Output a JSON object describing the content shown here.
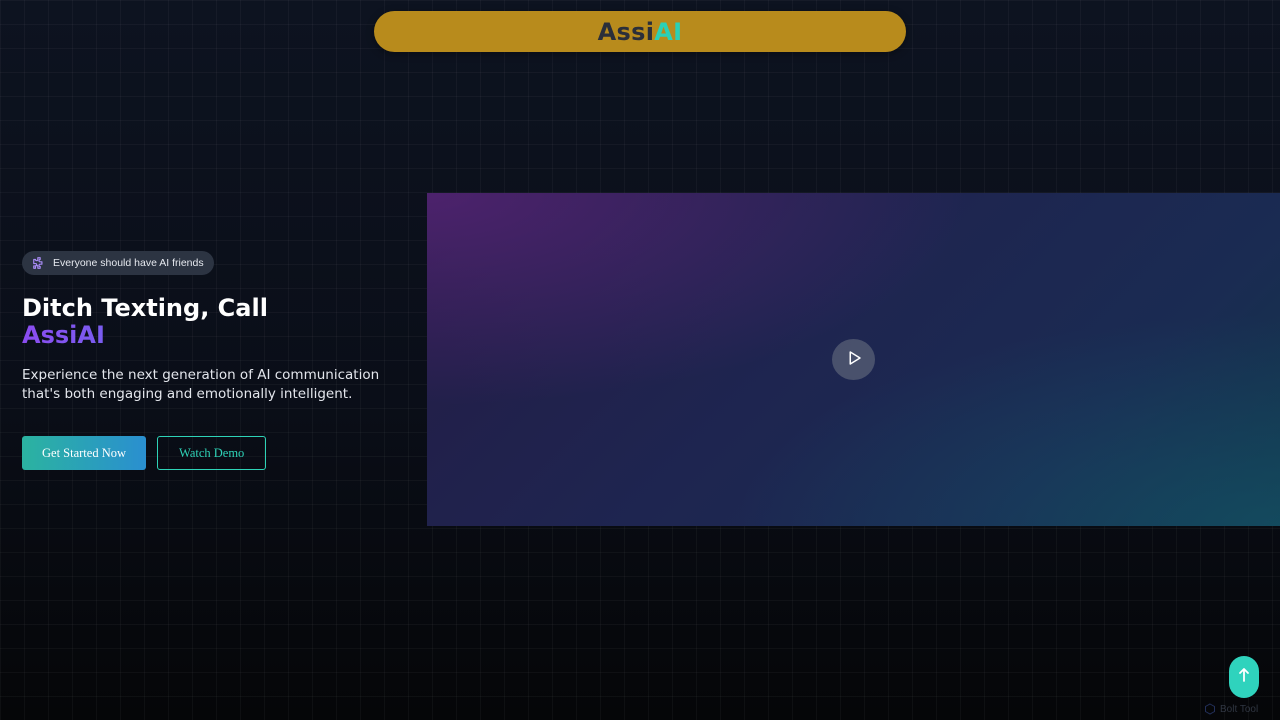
{
  "brand": {
    "name_part1": "Assi",
    "name_part2": "AI"
  },
  "hero": {
    "badge_icon": "puzzle-icon",
    "badge_text": "Everyone should have AI friends",
    "headline_line1": "Ditch Texting, Call",
    "headline_accent": "AssiAI",
    "subtext": "Experience the next generation of AI communication that's both engaging and emotionally intelligent.",
    "primary_button": "Get Started Now",
    "secondary_button": "Watch Demo"
  },
  "video": {
    "play_icon": "play-icon"
  },
  "scroll_top": {
    "icon": "arrow-up-icon"
  },
  "watermark": {
    "icon": "logo-icon",
    "text": "Bolt Tool"
  },
  "colors": {
    "brand_pill": "#b88b1c",
    "accent_teal": "#2ed3b7",
    "accent_purple": "#8b4cf0",
    "background": "#070a12"
  }
}
